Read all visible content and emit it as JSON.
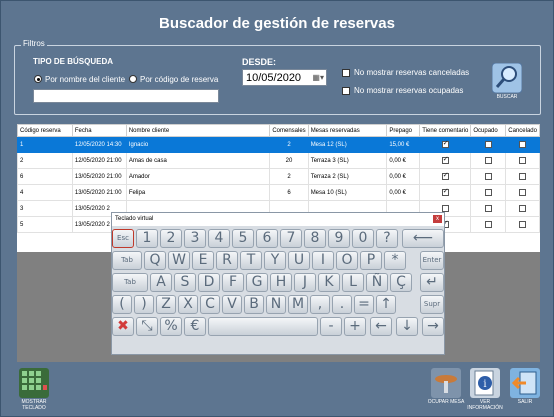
{
  "title": "Buscador de gestión de reservas",
  "filtros": {
    "legend": "Filtros",
    "tipo_label": "TIPO DE BÚSQUEDA",
    "radio_nombre": "Por nombre del cliente",
    "radio_codigo": "Por código de reserva",
    "search_value": "",
    "desde_label": "DESDE:",
    "desde_value": "10/05/2020",
    "chk_canceladas": "No mostrar reservas canceladas",
    "chk_ocupadas": "No mostrar reservas ocupadas",
    "buscar_label": "BUSCAR"
  },
  "table": {
    "headers": [
      "Código reserva",
      "Fecha",
      "Nombre cliente",
      "Comensales",
      "Mesas reservadas",
      "Prepago",
      "Tiene comentario",
      "Ocupado",
      "Cancelado"
    ],
    "rows": [
      {
        "codigo": "1",
        "fecha": "12/05/2020 14:30",
        "nombre": "Ignacio",
        "comensales": "2",
        "mesas": "Mesa 12 (SL)",
        "prepago": "15,00 €",
        "comentario": true,
        "ocupado": false,
        "cancelado": false
      },
      {
        "codigo": "2",
        "fecha": "12/05/2020 21:00",
        "nombre": "Amas de casa",
        "comensales": "20",
        "mesas": "Terraza 3 (SL)",
        "prepago": "0,00 €",
        "comentario": true,
        "ocupado": false,
        "cancelado": false
      },
      {
        "codigo": "6",
        "fecha": "13/05/2020 21:00",
        "nombre": "Amador",
        "comensales": "2",
        "mesas": "Terraza 2 (SL)",
        "prepago": "0,00 €",
        "comentario": true,
        "ocupado": false,
        "cancelado": false
      },
      {
        "codigo": "4",
        "fecha": "13/05/2020 21:00",
        "nombre": "Felipa",
        "comensales": "6",
        "mesas": "Mesa 10 (SL)",
        "prepago": "0,00 €",
        "comentario": true,
        "ocupado": false,
        "cancelado": false
      },
      {
        "codigo": "3",
        "fecha": "13/05/2020 2",
        "nombre": "",
        "comensales": "",
        "mesas": "",
        "prepago": "",
        "comentario": false,
        "ocupado": false,
        "cancelado": false
      },
      {
        "codigo": "5",
        "fecha": "13/05/2020 2",
        "nombre": "",
        "comensales": "",
        "mesas": "",
        "prepago": "",
        "comentario": true,
        "ocupado": false,
        "cancelado": false
      }
    ]
  },
  "keyboard": {
    "title": "Teclado virtual",
    "close": "x",
    "row1": [
      "Esc",
      "1",
      "2",
      "3",
      "4",
      "5",
      "6",
      "7",
      "8",
      "9",
      "0",
      "?",
      "⟵"
    ],
    "row2": [
      "Tab",
      "Q",
      "W",
      "E",
      "R",
      "T",
      "Y",
      "U",
      "I",
      "O",
      "P",
      "*",
      "Enter"
    ],
    "row3": [
      "Tab",
      "A",
      "S",
      "D",
      "F",
      "G",
      "H",
      "J",
      "K",
      "L",
      "Ñ",
      "Ç",
      "↵"
    ],
    "row4": [
      "(",
      ")",
      "Z",
      "X",
      "C",
      "V",
      "B",
      "N",
      "M",
      ",",
      ".",
      "=",
      "↑",
      "Supr"
    ],
    "row5": [
      "✖",
      "⤡",
      "%",
      "€",
      "",
      "-",
      "+",
      "←",
      "↓",
      "→"
    ]
  },
  "bottom": {
    "mostrar_teclado": "MOSTRAR TECLADO",
    "ocupar_mesa": "OCUPAR MESA",
    "ver_informacion": "VER INFORMACIÓN",
    "salir": "SALIR"
  }
}
